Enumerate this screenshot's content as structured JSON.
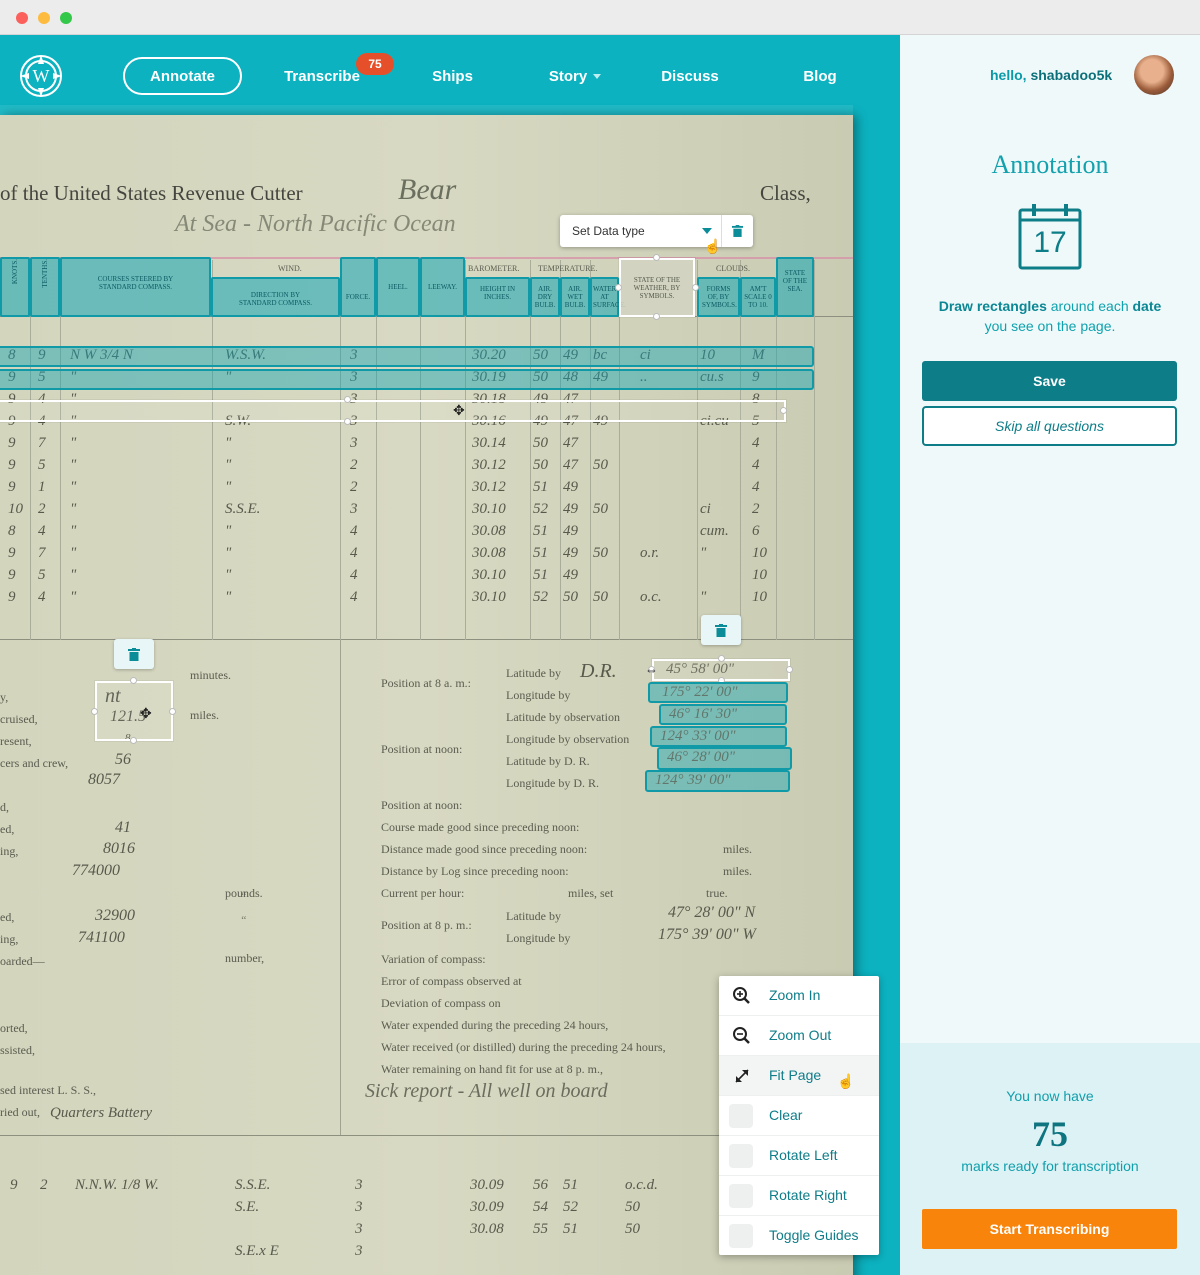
{
  "nav": {
    "logo_letter": "W",
    "items": [
      "Annotate",
      "Transcribe",
      "Ships",
      "Story",
      "Discuss",
      "Blog"
    ],
    "transcribe_badge": "75"
  },
  "document": {
    "title_printed": "of the United States Revenue Cutter",
    "ship_name": "Bear",
    "class_label": "Class,",
    "location": "At Sea - North Pacific Ocean",
    "column_headers": [
      "KNOTS.",
      "TENTHS.",
      "COURSES STEERED BY STANDARD COMPASS.",
      "DIRECTION BY STANDARD COMPASS.",
      "FORCE.",
      "HEEL.",
      "LEEWAY.",
      "HEIGHT IN INCHES.",
      "AIR. DRY BULB.",
      "AIR. WET BULB.",
      "WATER AT SURFACE.",
      "STATE OF THE WEATHER, BY SYMBOLS.",
      "FORMS OF, BY SYMBOLS.",
      "AM'T SCALE 0 TO 10.",
      "STATE OF THE SEA."
    ],
    "group_headers": [
      "WIND.",
      "BAROMETER.",
      "TEMPERATURE.",
      "CLOUDS."
    ],
    "rows": [
      [
        "8",
        "9",
        "N W 3/4 N",
        "W.S.W.",
        "3",
        "30.20",
        "50",
        "49",
        "bc",
        "ci",
        "10",
        "M"
      ],
      [
        "9",
        "5",
        "\"",
        "\"",
        "3",
        "30.19",
        "50",
        "48",
        "49",
        "..",
        "cu.s",
        "9"
      ],
      [
        "9",
        "4",
        "\"",
        "",
        "3",
        "30.18",
        "49",
        "47",
        "",
        "",
        "",
        "8"
      ],
      [
        "9",
        "4",
        "\"",
        "S.W.",
        "3",
        "30.16",
        "49",
        "47",
        "49",
        "",
        "ci.cu",
        "5"
      ],
      [
        "9",
        "7",
        "\"",
        "\"",
        "3",
        "30.14",
        "50",
        "47",
        "",
        "",
        "",
        "4"
      ],
      [
        "9",
        "5",
        "\"",
        "\"",
        "2",
        "30.12",
        "50",
        "47",
        "50",
        "",
        "",
        "4"
      ],
      [
        "9",
        "1",
        "\"",
        "\"",
        "2",
        "30.12",
        "51",
        "49",
        "",
        "",
        "",
        "4"
      ],
      [
        "10",
        "2",
        "\"",
        "S.S.E.",
        "3",
        "30.10",
        "52",
        "49",
        "50",
        "",
        "ci",
        "2"
      ],
      [
        "8",
        "4",
        "\"",
        "\"",
        "4",
        "30.08",
        "51",
        "49",
        "",
        "",
        "cum.",
        "6"
      ],
      [
        "9",
        "7",
        "\"",
        "\"",
        "4",
        "30.08",
        "51",
        "49",
        "50",
        "o.r.",
        "\"",
        "10"
      ],
      [
        "9",
        "5",
        "\"",
        "\"",
        "4",
        "30.10",
        "51",
        "49",
        "",
        "",
        "",
        "10"
      ],
      [
        "9",
        "4",
        "\"",
        "\"",
        "4",
        "30.10",
        "52",
        "50",
        "50",
        "o.c.",
        "\"",
        "10"
      ]
    ],
    "left_labels": [
      "minutes.",
      "y,",
      "cruised,",
      "resent,",
      "cers and crew,",
      "d,",
      "ed,",
      "ing,",
      "ed,",
      "ing,",
      "oarded—",
      "orted,",
      "ssisted,",
      "sed interest L. S. S.,",
      "ried out,"
    ],
    "left_values": [
      "nt",
      "121.5",
      "8",
      "56",
      "8057",
      "41",
      "8016",
      "774000",
      "32900",
      "741100"
    ],
    "left_units": [
      "miles.",
      "pounds.",
      "number,"
    ],
    "quarters_note": "Quarters Battery",
    "position_8am": "Position at 8 a. m.:",
    "position_noon": "Position at noon:",
    "position_noon2": "Position at noon:",
    "position_8pm": "Position at 8 p. m.:",
    "lat_by": "Latitude by",
    "dr_note": "D.R.",
    "lon_by": "Longitude by",
    "lat_obs": "Latitude by observation",
    "lon_obs": "Longitude by observation",
    "lat_dr": "Latitude by D. R.",
    "lon_dr": "Longitude by D. R.",
    "coords": [
      "45° 58' 00\"",
      "175° 22' 00\"",
      "46° 16' 30\"",
      "124° 33' 00\"",
      "46° 28' 00\"",
      "124° 39' 00\""
    ],
    "coords_8pm": [
      "47° 28' 00\" N",
      "175° 39' 00\" W"
    ],
    "lines": [
      "Course made good since preceding noon:",
      "Distance made good since preceding noon:",
      "Distance by Log since preceding noon:",
      "Current per hour:",
      "Variation of compass:",
      "Error of compass observed at",
      "Deviation of compass on",
      "Water expended during the preceding 24 hours,",
      "Water received (or distilled) during the preceding 24 hours,",
      "Water remaining on hand fit for use at 8 p. m.,"
    ],
    "miles_label": "miles.",
    "miles_set": "miles, set",
    "true_label": "true.",
    "sick_report": "Sick report - All well on board",
    "lower_rows": [
      [
        "9",
        "2",
        "N.N.W. 1/8 W.",
        "S.S.E.",
        "3",
        "30.09",
        "56",
        "51",
        "o.c.d."
      ],
      [
        "",
        "",
        "",
        "S.E.",
        "3",
        "30.09",
        "54",
        "52",
        "50"
      ],
      [
        "",
        "",
        "",
        "",
        "3",
        "30.08",
        "55",
        "51",
        "50"
      ],
      [
        "",
        "",
        "",
        "S.E.x E",
        "3",
        "",
        "",
        "",
        ""
      ]
    ]
  },
  "toolbar_popup": {
    "data_type_label": "Set Data type"
  },
  "zoom_menu": {
    "items": [
      "Zoom In",
      "Zoom Out",
      "Fit Page",
      "Clear",
      "Rotate Left",
      "Rotate Right",
      "Toggle Guides"
    ]
  },
  "panel": {
    "hello_prefix": "hello,",
    "username": "shabadoo5k",
    "title": "Annotation",
    "calendar_day": "17",
    "instruction_bold1": "Draw rectangles",
    "instruction_mid": " around each ",
    "instruction_bold2": "date",
    "instruction_tail": "you see on the page.",
    "save_label": "Save",
    "skip_label": "Skip all questions",
    "marks_prefix": "You now have",
    "marks_count": "75",
    "marks_suffix": "marks ready for transcription",
    "start_label": "Start Transcribing"
  },
  "colors": {
    "brand": "#0cb2c0",
    "dark": "#0d7d88",
    "badge": "#e5502b",
    "cta": "#f8840b"
  }
}
